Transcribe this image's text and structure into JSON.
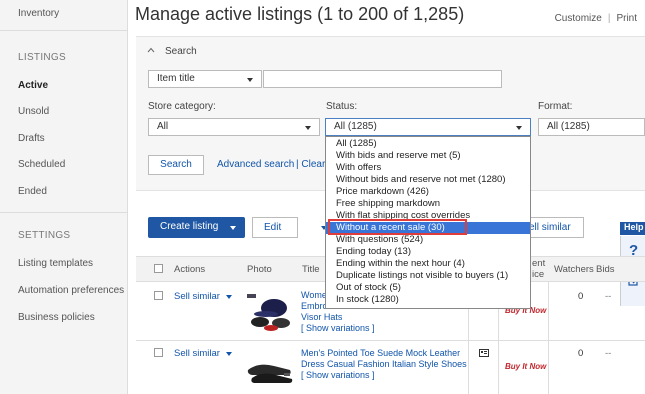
{
  "sidebar": {
    "top_item": "Inventory",
    "listings_heading": "LISTINGS",
    "listings": [
      "Active",
      "Unsold",
      "Drafts",
      "Scheduled",
      "Ended"
    ],
    "settings_heading": "SETTINGS",
    "settings": [
      "Listing templates",
      "Automation preferences",
      "Business policies"
    ]
  },
  "header": {
    "title": "Manage active listings (1 to 200 of 1,285)",
    "customize": "Customize",
    "separator": "|",
    "print": "Print"
  },
  "search": {
    "toggle_label": "Search",
    "field_select": "Item title",
    "store_category_label": "Store category:",
    "store_category_value": "All",
    "status_label": "Status:",
    "status_value": "All (1285)",
    "format_label": "Format:",
    "format_value": "All (1285)",
    "search_button": "Search",
    "advanced_search": "Advanced search",
    "clear_fragment": "| Clear"
  },
  "status_options": [
    "All (1285)",
    "With bids and reserve met (5)",
    "With offers",
    "Without bids and reserve not met (1280)",
    "Price markdown (426)",
    "Free shipping markdown",
    "With flat shipping cost overrides",
    "Without a recent sale (30)",
    "With questions (524)",
    "Ending today (13)",
    "Ending within the next hour (4)",
    "Duplicate listings not visible to buyers (1)",
    "Out of stock (5)",
    "In stock (1280)"
  ],
  "selected_status_index": 7,
  "toolbar": {
    "create_listing": "Create listing",
    "edit": "Edit",
    "sell_similar": "ell similar",
    "help": "Help"
  },
  "table": {
    "headers": {
      "actions": "Actions",
      "photo": "Photo",
      "title": "Title",
      "format_fragment": "ent",
      "format_fragment2": "ice",
      "watchers": "Watchers",
      "bids": "Bids"
    },
    "rows": [
      {
        "action": "Sell similar",
        "title_line1": "Wome",
        "title_line2": "Embro",
        "title_line3": "Visor Hats",
        "show_variations": "[ Show variations ]",
        "buy_it_now": "Buy It Now",
        "watchers": "0",
        "bids": "--"
      },
      {
        "action": "Sell similar",
        "title_line1": "Men's Pointed Toe Suede Mock Leather",
        "title_line2": "Dress Casual Fashion Italian Style Shoes",
        "show_variations": "[ Show variations ]",
        "buy_it_now": "Buy It Now",
        "watchers": "0",
        "bids": "--"
      }
    ]
  },
  "colors": {
    "primary_button": "#1f57a4",
    "link": "#1155aa",
    "selected_option": "#3875d7",
    "highlight_border": "#e03c3c",
    "buy_it_now": "#c0272d"
  },
  "icons": [
    "chevron-up-icon",
    "caret-down-icon",
    "question-icon",
    "edit-note-icon",
    "variation-grid-icon"
  ]
}
